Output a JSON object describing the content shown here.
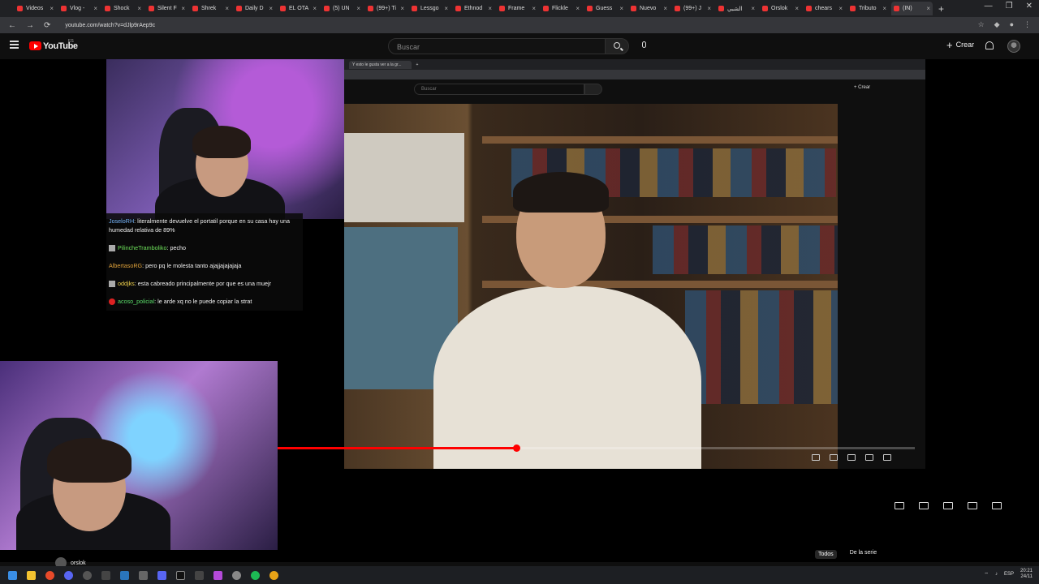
{
  "browser": {
    "tabs": [
      {
        "label": "Videos"
      },
      {
        "label": "Vlog -"
      },
      {
        "label": "Shock"
      },
      {
        "label": "Silent F"
      },
      {
        "label": "Shrek"
      },
      {
        "label": "Daily D"
      },
      {
        "label": "EL OTA"
      },
      {
        "label": "(5) UN"
      },
      {
        "label": "(99+) Ti"
      },
      {
        "label": "Lessgo"
      },
      {
        "label": "Ethnod"
      },
      {
        "label": "Frame"
      },
      {
        "label": "Flickle"
      },
      {
        "label": "Guess"
      },
      {
        "label": "Nuevo"
      },
      {
        "label": "(99+) J"
      },
      {
        "label": "الشبي"
      },
      {
        "label": "Orslok"
      },
      {
        "label": "chears"
      },
      {
        "label": "Tributo"
      },
      {
        "label": "(IN)"
      }
    ],
    "url": "youtube.com/watch?v=dJlp9rAep9c"
  },
  "youtube": {
    "logo_text": "YouTube",
    "country": "ES",
    "search_placeholder": "Buscar",
    "create_label": "Crear"
  },
  "nested_browser": {
    "tab_label": "Y esto le gusta ver a la gr...",
    "search_placeholder": "Buscar",
    "create_label": "Crear"
  },
  "chat": {
    "messages": [
      {
        "user": "JoseloRH",
        "text": "literalmente devuelve el portatil porque en su casa hay una humedad relativa de 89%"
      },
      {
        "user": "PilincheTramboliko",
        "text": "pecho"
      },
      {
        "user": "AlbertasoRG",
        "text": "pero pq le molesta tanto ajajjajajajaja"
      },
      {
        "user": "oddjks",
        "text": "esta cabreado principalmente por que es una muejr"
      },
      {
        "user": "acoso_policial",
        "text": "le arde xq no le puede copiar la strat"
      }
    ]
  },
  "player": {
    "progress_fraction": 0.375
  },
  "below_video": {
    "channel_name": "orslok",
    "chips": [
      "Todos",
      "De la serie"
    ]
  },
  "taskbar": {
    "language": "ESP",
    "time": "20:21",
    "date": "24/11"
  },
  "colors": {
    "youtube_red": "#ff0000",
    "background": "#0f0f0f"
  }
}
